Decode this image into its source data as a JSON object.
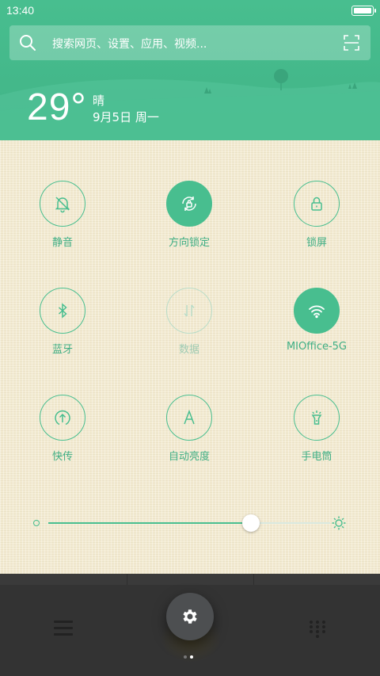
{
  "status": {
    "time": "13:40",
    "battery_level": 1.0
  },
  "search": {
    "placeholder": "搜索网页、设置、应用、视频..."
  },
  "weather": {
    "temperature": "29°",
    "condition": "晴",
    "date": "9月5日 周一"
  },
  "toggles": [
    {
      "label": "静音",
      "icon": "bell-muted-icon",
      "state": "off"
    },
    {
      "label": "方向锁定",
      "icon": "rotation-lock-icon",
      "state": "on"
    },
    {
      "label": "锁屏",
      "icon": "lock-icon",
      "state": "off"
    },
    {
      "label": "蓝牙",
      "icon": "bluetooth-icon",
      "state": "off"
    },
    {
      "label": "数据",
      "icon": "mobile-data-icon",
      "state": "disabled"
    },
    {
      "label": "MIOffice-5G",
      "icon": "wifi-icon",
      "state": "on"
    },
    {
      "label": "快传",
      "icon": "share-upload-icon",
      "state": "off"
    },
    {
      "label": "自动亮度",
      "icon": "auto-brightness-icon",
      "state": "off"
    },
    {
      "label": "手电筒",
      "icon": "flashlight-icon",
      "state": "off"
    }
  ],
  "brightness": {
    "level": 0.72
  },
  "dock": {
    "page_count": 2,
    "active_page": 2
  },
  "colors": {
    "accent": "#48be8f",
    "panel": "#f3ebd2",
    "dock": "#333333"
  }
}
